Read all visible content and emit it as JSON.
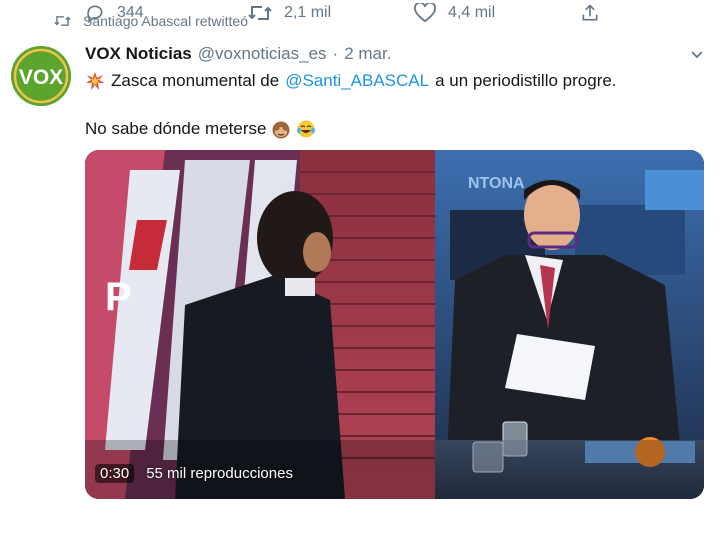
{
  "retweet_header": {
    "text": "Santiago Abascal retwitteó",
    "icon": "retweet-icon"
  },
  "author": {
    "avatar_text": "VOX",
    "name": "VOX Noticias",
    "handle": "@voxnoticias_es",
    "separator": "·",
    "date": "2 mar."
  },
  "tweet": {
    "line1_emoji": "collision-emoji",
    "line1_text_before": "Zasca monumental de",
    "line1_mention": "@Santi_ABASCAL",
    "line1_text_after": "a un periodistillo progre.",
    "line2_text": "No sabe dónde meterse",
    "line2_emojis": [
      "see-no-evil-monkey-emoji",
      "face-with-tears-of-joy-emoji"
    ]
  },
  "video": {
    "duration": "0:30",
    "views": "55 mil reproducciones"
  },
  "actions": {
    "replies": "344",
    "retweets": "2,1 mil",
    "likes": "4,4 mil"
  },
  "colors": {
    "brand_green": "#5ba52f",
    "link_blue": "#1b95e0",
    "muted_gray": "#657786"
  }
}
